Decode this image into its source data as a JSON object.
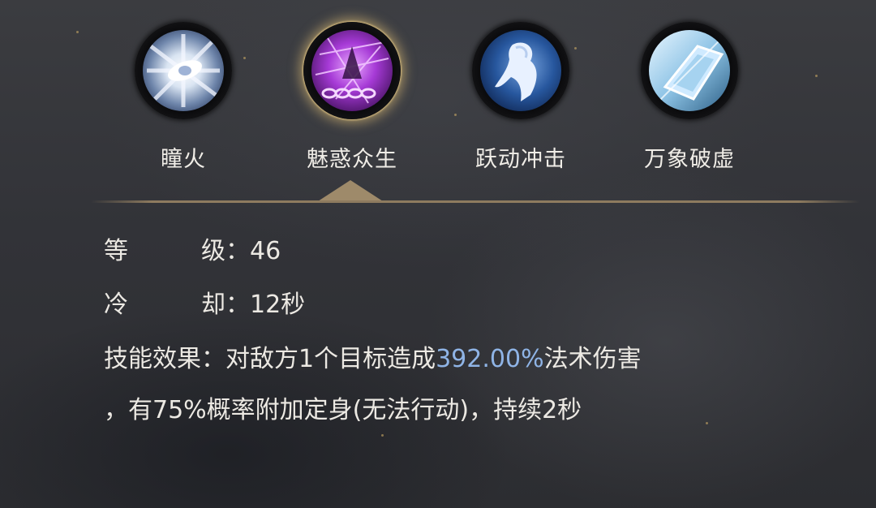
{
  "skills": [
    {
      "name": "瞳火",
      "icon": "eye-flame-icon",
      "selected": false
    },
    {
      "name": "魅惑众生",
      "icon": "charm-chains-icon",
      "selected": true
    },
    {
      "name": "跃动冲击",
      "icon": "leap-strike-icon",
      "selected": false
    },
    {
      "name": "万象破虚",
      "icon": "crystal-shatter-icon",
      "selected": false
    }
  ],
  "details": {
    "level_label_1": "等",
    "level_label_2": "级：",
    "level_value": "46",
    "cooldown_label_1": "冷",
    "cooldown_label_2": "却：",
    "cooldown_value": "12秒",
    "effect_label": "技能效果：",
    "effect_text_before": "对敌方1个目标造成",
    "effect_damage": "392.00%",
    "effect_text_after": "法术伤害",
    "effect_line2": "，有75%概率附加定身(无法行动)，持续2秒"
  },
  "colors": {
    "damage_highlight": "#8fb4e6",
    "selected_glow": "#e8c478",
    "divider": "#8e7b5f"
  }
}
